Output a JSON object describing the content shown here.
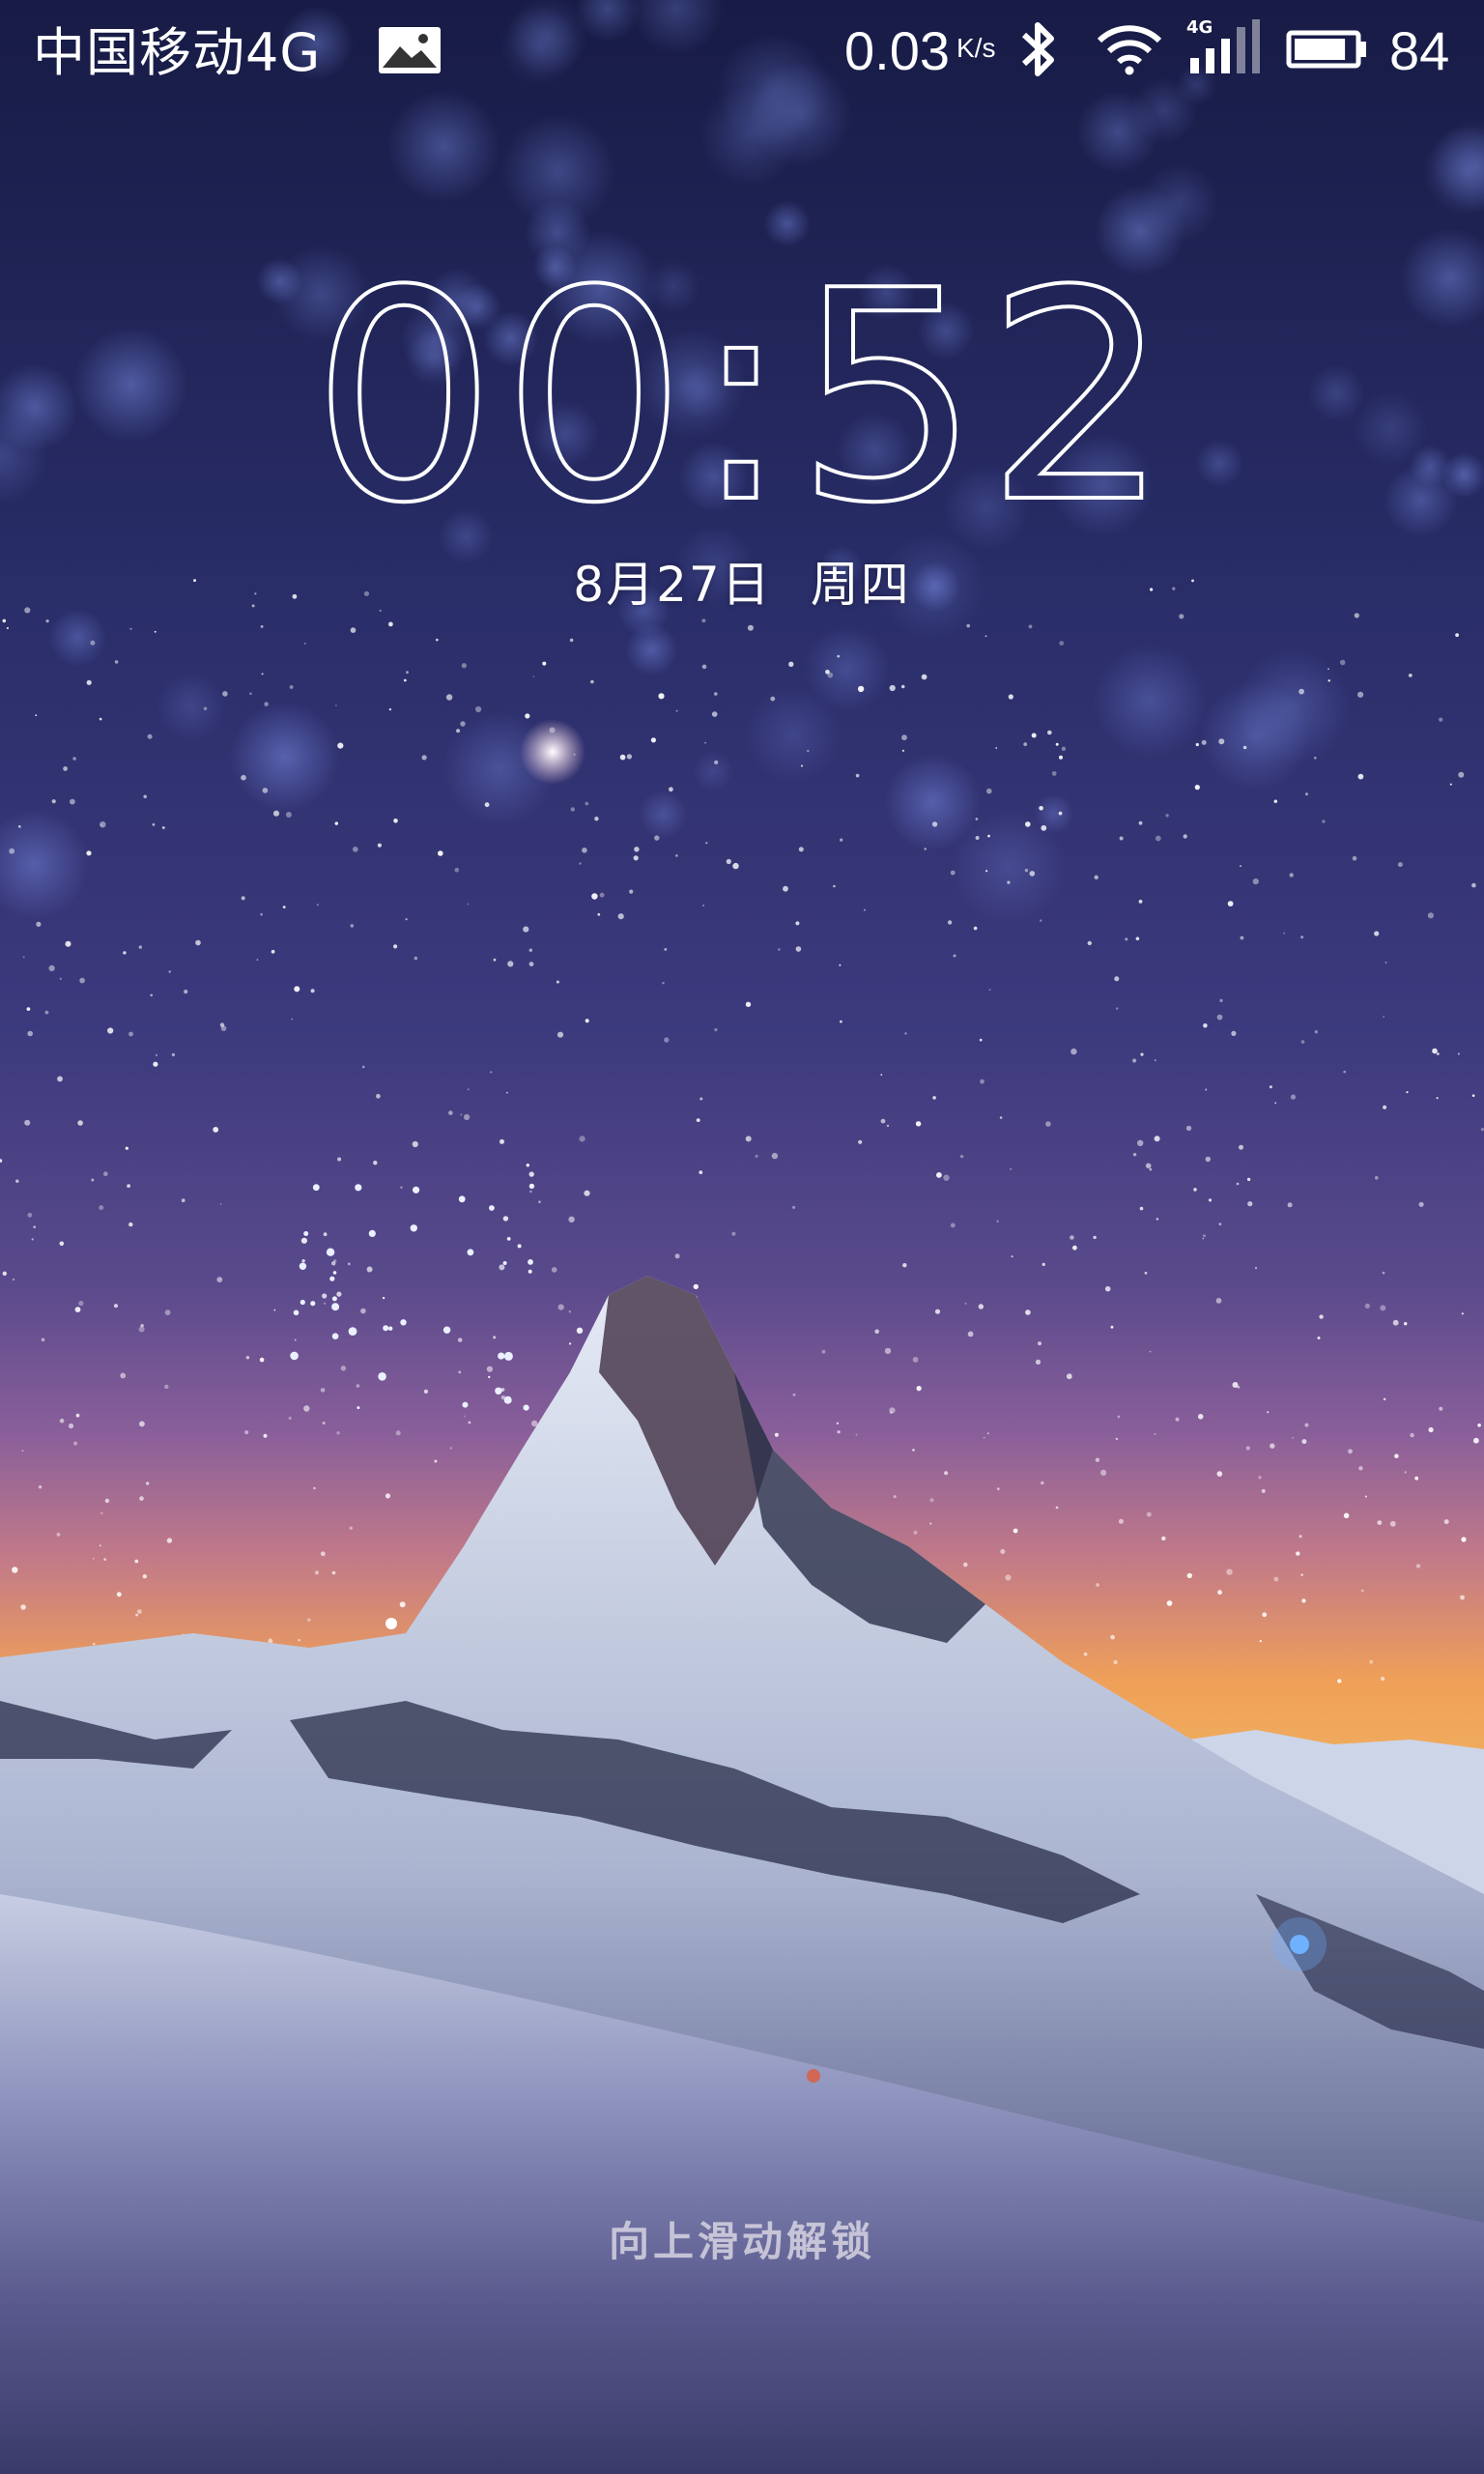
{
  "status_bar": {
    "carrier": "中国移动4G",
    "notification_icon": "gallery-icon",
    "net_speed": "0.03",
    "net_speed_unit": "K/s",
    "bluetooth_icon": "bluetooth-icon",
    "wifi_icon": "wifi-icon",
    "signal_icon": "signal-4g-icon",
    "signal_label": "4G",
    "battery_icon": "battery-icon",
    "battery_percent": "84"
  },
  "lock_screen": {
    "time": "00:52",
    "date": "8月27日",
    "weekday": "周四",
    "unlock_hint": "向上滑动解锁"
  },
  "colors": {
    "sky_top": "#1b2050",
    "sky_mid": "#3a3a7a",
    "horizon_glow": "#f0a050",
    "snow": "#dfe6f2"
  }
}
